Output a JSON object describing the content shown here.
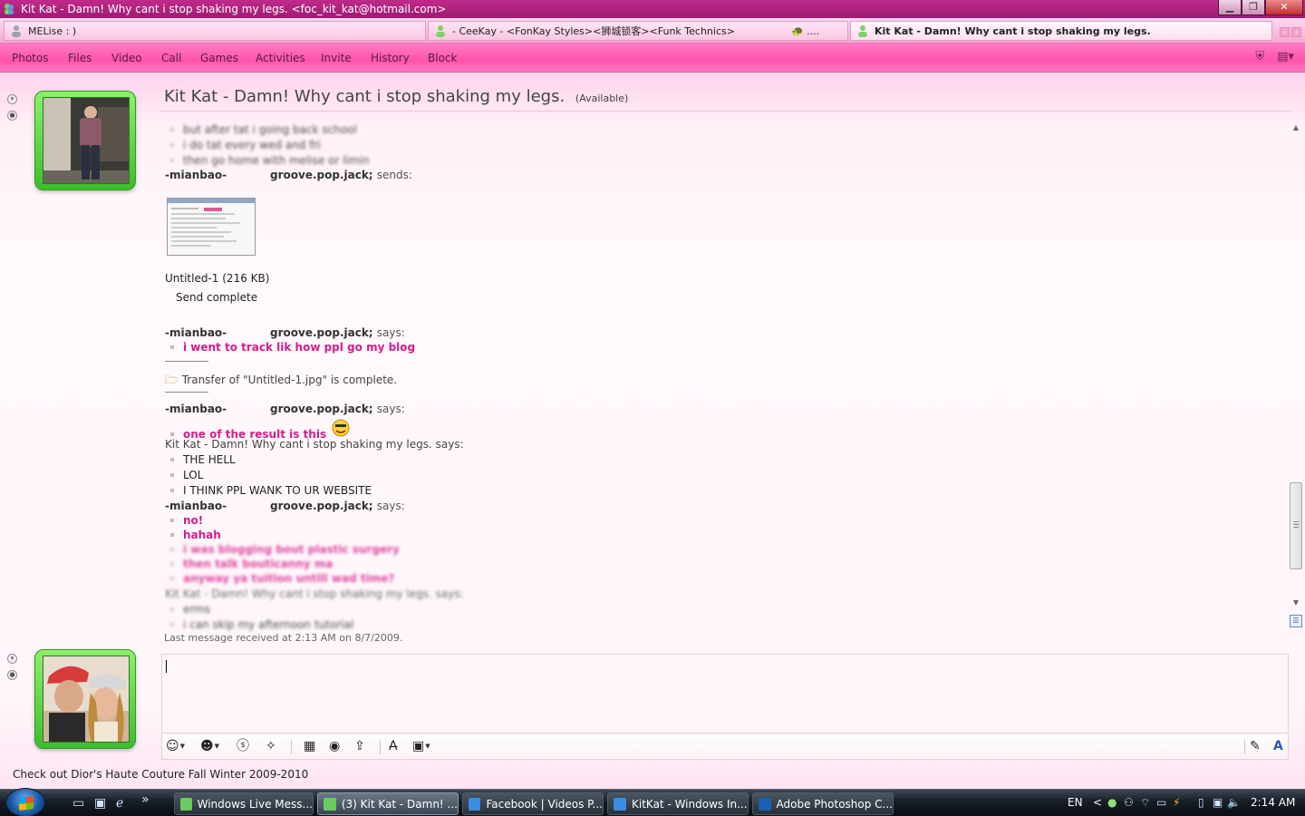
{
  "window": {
    "title": "Kit Kat - Damn! Why cant i stop shaking my legs. <foc_kit_kat@hotmail.com>",
    "minimize": "▁",
    "maximize": "❐",
    "close": "✕"
  },
  "tabs": [
    {
      "label": "MELise : )"
    },
    {
      "label": "- CeeKay - <FonKay Styles><狮城锁客><Funk Technics>",
      "extra": "🐢 ...."
    },
    {
      "label": "Kit Kat - Damn! Why cant i stop shaking my legs."
    }
  ],
  "menu": {
    "items": [
      "Photos",
      "Files",
      "Video",
      "Call",
      "Games",
      "Activities",
      "Invite",
      "History",
      "Block"
    ],
    "right_icons": [
      "block-contact-icon",
      "display-options-icon"
    ]
  },
  "conversation": {
    "contact_name": "Kit Kat - Damn! Why cant i stop shaking my legs.",
    "status": "(Available)",
    "last_message": "Last message received at 2:13 AM on 8/7/2009."
  },
  "messages": {
    "blurred_top": [
      "but after tat i going back school",
      "i do tat every wed and fri",
      "then go home with melise or limin"
    ],
    "sender_a": "-mianbao-",
    "sender_b": "groove.pop.jack;",
    "sends": "sends:",
    "says": "says:",
    "file_name": "Untitled-1 (216 KB)",
    "file_status": "Send complete",
    "msg1": "i went to track lik how ppl go my blog",
    "transfer": "Transfer of \"Untitled-1.jpg\" is complete.",
    "msg2": "one of the result is this",
    "kitkat_says": "Kit Kat - Damn! Why cant i stop shaking my legs. says:",
    "kitkat_lines": [
      "THE HELL",
      "LOL",
      "I THINK PPL WANK TO UR WEBSITE"
    ],
    "reply_lines": [
      "no!",
      "hahah"
    ],
    "blurred_replies": [
      "i was blogging bout plastic surgery",
      "then talk bouticanny ma",
      "anyway ya tuition untill wad time?"
    ],
    "blurred_kitkat_says": "Kit Kat - Damn! Why cant i stop shaking my legs. says:",
    "blurred_kitkat_lines": [
      "erms",
      "i can skip my afternoon tutorial"
    ]
  },
  "compose": {
    "text": ""
  },
  "ad": {
    "text": "Check out Dior's Haute Couture Fall Winter 2009-2010"
  },
  "taskbar": {
    "buttons": [
      {
        "label": "Windows Live Mess...",
        "icon": "messenger-icon"
      },
      {
        "label": "(3) Kit Kat - Damn! ...",
        "icon": "messenger-icon"
      },
      {
        "label": "Facebook | Videos P...",
        "icon": "ie-icon"
      },
      {
        "label": "KitKat - Windows In...",
        "icon": "ie-icon"
      },
      {
        "label": "Adobe Photoshop C...",
        "icon": "photoshop-icon"
      }
    ],
    "quicklaunch_more": "»",
    "language": "EN",
    "tray_arrow": "<",
    "clock": "2:14 AM"
  }
}
